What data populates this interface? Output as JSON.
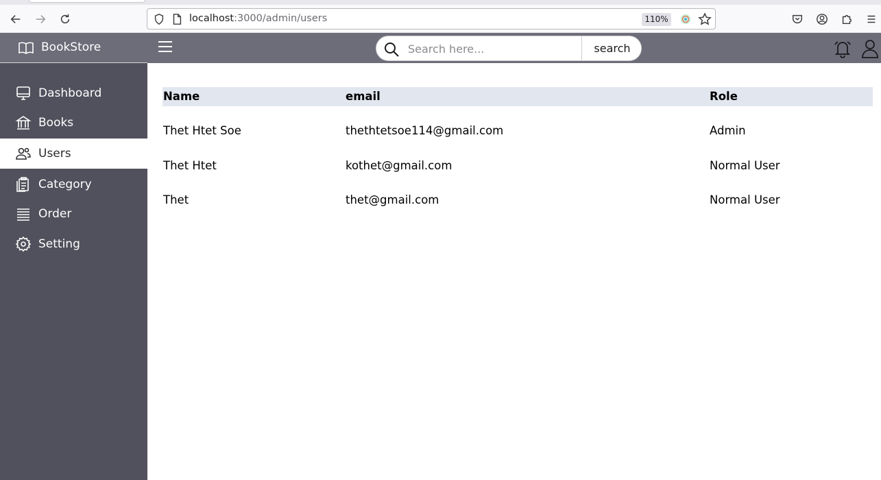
{
  "browser": {
    "url_host": "localhost",
    "url_path": ":3000/admin/users",
    "zoom": "110%"
  },
  "sidebar": {
    "brand": "BookStore",
    "items": [
      {
        "label": "Dashboard",
        "icon": "monitor-icon",
        "active": false
      },
      {
        "label": "Books",
        "icon": "bank-icon",
        "active": false
      },
      {
        "label": "Users",
        "icon": "users-icon",
        "active": true
      },
      {
        "label": "Category",
        "icon": "clipboard-icon",
        "active": false
      },
      {
        "label": "Order",
        "icon": "list-icon",
        "active": false
      },
      {
        "label": "Setting",
        "icon": "gear-icon",
        "active": false
      }
    ]
  },
  "header": {
    "search_placeholder": "Search here...",
    "search_button": "search"
  },
  "table": {
    "columns": [
      "Name",
      "email",
      "Role"
    ],
    "rows": [
      {
        "name": "Thet Htet Soe",
        "email": "thethtetsoe114@gmail.com",
        "role": "Admin"
      },
      {
        "name": "Thet Htet",
        "email": "kothet@gmail.com",
        "role": "Normal User"
      },
      {
        "name": "Thet",
        "email": "thet@gmail.com",
        "role": "Normal User"
      }
    ]
  },
  "colors": {
    "sidebar_bg": "#50515c",
    "topbar_bg": "#6c6d78",
    "table_header_bg": "#e2e6ef"
  }
}
